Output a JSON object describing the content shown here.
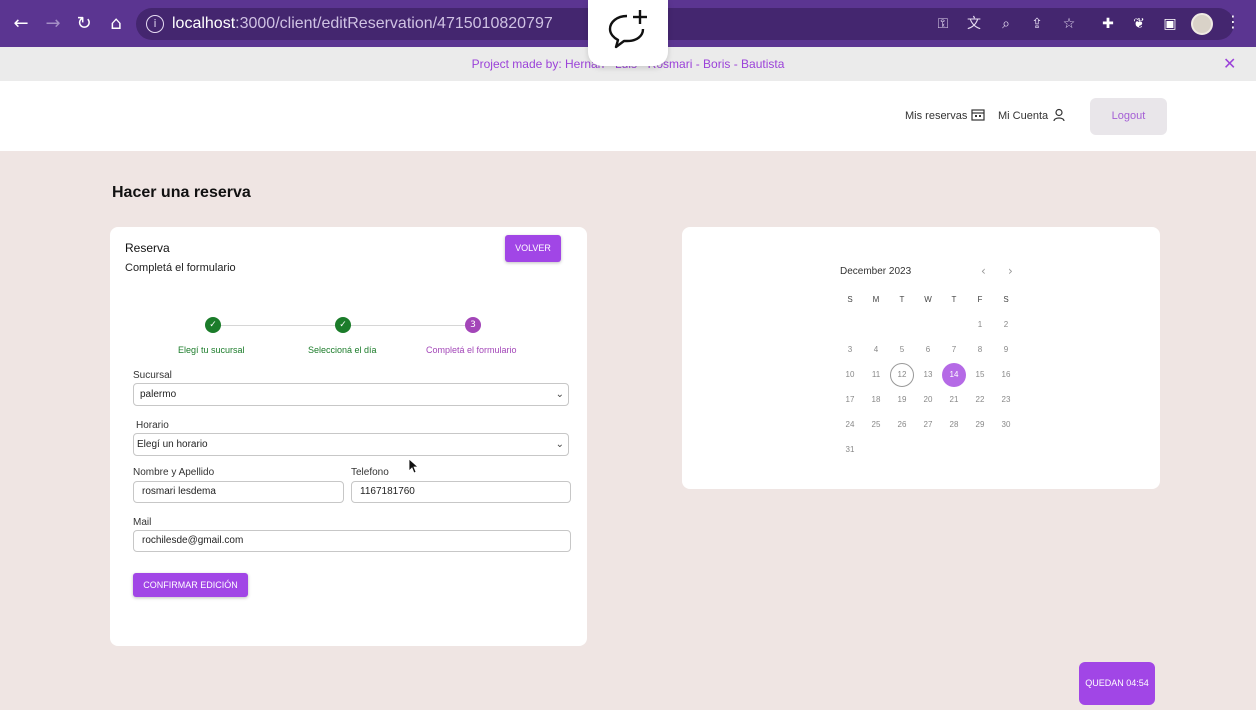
{
  "browser": {
    "url_host": "localhost",
    "url_path": ":3000/client/editReservation/4715010820797",
    "icons": [
      "back-icon",
      "forward-icon",
      "reload-icon",
      "home-icon",
      "info-icon",
      "key-icon",
      "translate-icon",
      "zoom-icon",
      "share-icon",
      "star-icon",
      "extensions-icon",
      "extension-leaf-icon",
      "side-panel-icon",
      "avatar",
      "menu-icon"
    ]
  },
  "banner": {
    "text": "Project made by: Hernán - Luis - Rosmari - Boris - Bautista"
  },
  "header": {
    "mis_reservas": "Mis reservas",
    "mi_cuenta": "Mi Cuenta",
    "logout": "Logout"
  },
  "page": {
    "title": "Hacer una reserva"
  },
  "form": {
    "title": "Reserva",
    "subtitle": "Completá el formulario",
    "volver": "VOLVER",
    "steps": [
      {
        "label": "Elegí tu sucursal",
        "state": "done"
      },
      {
        "label": "Seleccioná el día",
        "state": "done"
      },
      {
        "label": "Completá el formulario",
        "state": "active",
        "number": "3"
      }
    ],
    "sucursal_label": "Sucursal",
    "sucursal_value": "palermo",
    "horario_label": "Horario",
    "horario_value": "Elegí un horario",
    "nombre_label": "Nombre y Apellido",
    "nombre_value": "rosmari lesdema",
    "telefono_label": "Telefono",
    "telefono_value": "1167181760",
    "mail_label": "Mail",
    "mail_value": "rochilesde@gmail.com",
    "confirm": "CONFIRMAR EDICIÓN"
  },
  "calendar": {
    "month": "December 2023",
    "weekdays": [
      "S",
      "M",
      "T",
      "W",
      "T",
      "F",
      "S"
    ],
    "first_weekday_index": 5,
    "days_in_month": 31,
    "today": 12,
    "selected": 14
  },
  "timer": {
    "label": "QUEDAN 04:54"
  },
  "colors": {
    "accent": "#a146e6",
    "success": "#1b7c2a",
    "chrome": "#5b3591",
    "background": "#efe5e3"
  }
}
